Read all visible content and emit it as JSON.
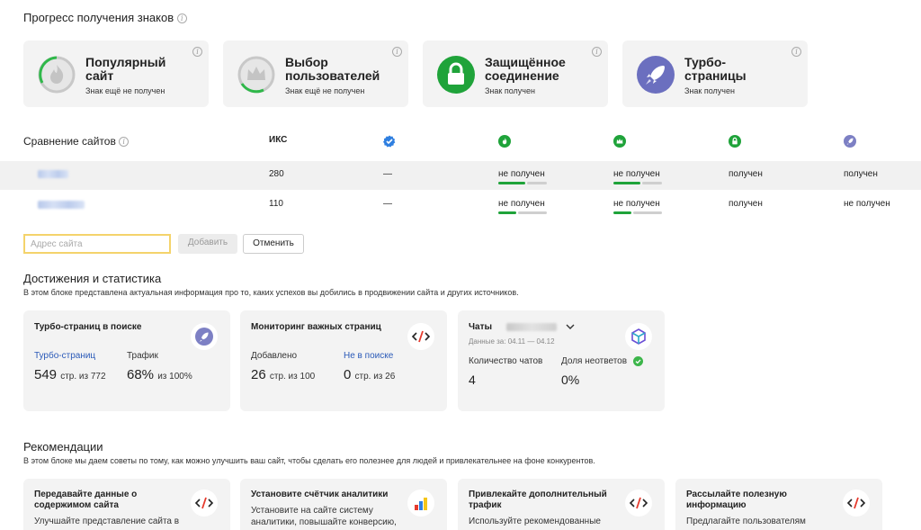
{
  "badges_section": {
    "title": "Прогресс получения знаков",
    "cards": [
      {
        "name_line1": "Популярный",
        "name_line2": "сайт",
        "status": "Знак ещё не получен"
      },
      {
        "name_line1": "Выбор",
        "name_line2": "пользователей",
        "status": "Знак ещё не получен"
      },
      {
        "name_line1": "Защищённое",
        "name_line2": "соединение",
        "status": "Знак получен"
      },
      {
        "name_line1": "Турбо-",
        "name_line2": "страницы",
        "status": "Знак получен"
      }
    ]
  },
  "comparison": {
    "title": "Сравнение сайтов",
    "iks_header": "ИКС",
    "rows": [
      {
        "iks": "280",
        "verified": "—",
        "popular": "не получен",
        "choice": "не получен",
        "secure": "получен",
        "turbo": "получен",
        "popular_progress": 0.55,
        "choice_progress": 0.55
      },
      {
        "iks": "110",
        "verified": "—",
        "popular": "не получен",
        "choice": "не получен",
        "secure": "получен",
        "turbo": "не получен",
        "popular_progress": 0.4,
        "choice_progress": 0.4
      }
    ]
  },
  "form": {
    "placeholder": "Адрес сайта",
    "add_label": "Добавить",
    "cancel_label": "Отменить"
  },
  "achievements": {
    "title": "Достижения и статистика",
    "description": "В этом блоке представлена актуальная информация про то, каких успехов вы добились в продвижении сайта и других источников.",
    "turbo": {
      "title": "Турбо-страниц в поиске",
      "label1": "Турбо-страниц",
      "label2": "Трафик",
      "value1": "549",
      "value1_suffix": "стр. из 772",
      "value2": "68%",
      "value2_suffix": "из 100%"
    },
    "monitoring": {
      "title": "Мониторинг важных страниц",
      "label1": "Добавлено",
      "label2": "Не в поиске",
      "value1": "26",
      "value1_suffix": "стр. из 100",
      "value2": "0",
      "value2_suffix": "стр. из 26"
    },
    "chats": {
      "title": "Чаты",
      "period": "Данные за: 04.11 — 04.12",
      "label1": "Количество чатов",
      "label2": "Доля неответов",
      "value1": "4",
      "value2": "0%"
    }
  },
  "recommendations": {
    "title": "Рекомендации",
    "description": "В этом блоке мы даем советы по тому, как можно улучшить ваш сайт, чтобы сделать его полезнее для людей и привлекательнее на фоне конкурентов.",
    "cards": [
      {
        "title_line1": "Передавайте данные о",
        "title_line2": "содержимом сайта",
        "text_line1": "Улучшайте представление сайта в"
      },
      {
        "title_line1": "Установите счётчик аналитики",
        "title_line2": "",
        "text_line1": "Установите на сайте систему",
        "text_line2": "аналитики, повышайте конверсию,"
      },
      {
        "title_line1": "Привлекайте дополнительный",
        "title_line2": "трафик",
        "text_line1": "Используйте рекомендованные"
      },
      {
        "title_line1": "Рассылайте полезную",
        "title_line2": "информацию",
        "text_line1": "Предлагайте пользователям"
      }
    ]
  },
  "colors": {
    "green": "#1fa33a",
    "purple": "#6b6fbf",
    "link_blue": "#2b5ab8",
    "input_border": "#f4d36b"
  }
}
